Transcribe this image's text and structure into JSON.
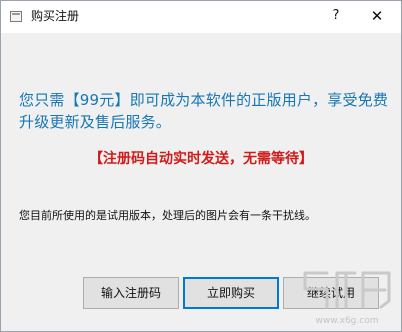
{
  "window": {
    "title": "购买注册",
    "help_label": "?",
    "close_label": "✕"
  },
  "content": {
    "main_message": "您只需【99元】即可成为本软件的正版用户，享受免费升级更新及售后服务。",
    "red_message": "【注册码自动实时发送，无需等待】",
    "trial_note": "您目前所使用的是试用版本，处理后的图片会有一条干扰线。"
  },
  "buttons": {
    "enter_code": "输入注册码",
    "buy_now": "立即购买",
    "continue_trial": "继续试用"
  },
  "watermark": {
    "url": "www.x6g.com"
  },
  "colors": {
    "accent_blue": "#1677b3",
    "alert_red": "#d21a1a",
    "focus_border": "#0078d7"
  }
}
